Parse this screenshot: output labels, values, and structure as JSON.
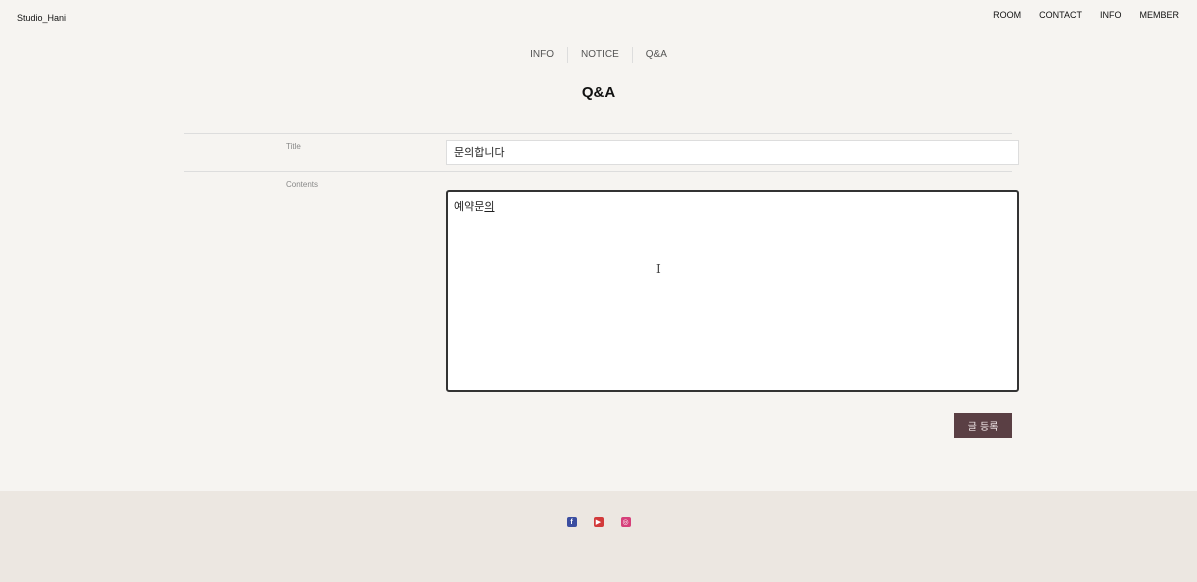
{
  "header": {
    "brand": "Studio_Hani",
    "nav": [
      "ROOM",
      "CONTACT",
      "INFO",
      "MEMBER"
    ]
  },
  "subnav": [
    "INFO",
    "NOTICE",
    "Q&A"
  ],
  "page_title": "Q&A",
  "form": {
    "title_label": "Title",
    "title_value": "문의합니다",
    "contents_label": "Contents",
    "contents_value_main": "예약문",
    "contents_value_composing": "의",
    "submit_label": "글 등록"
  },
  "footer": {
    "icons": [
      "facebook-icon",
      "youtube-icon",
      "instagram-icon"
    ]
  },
  "colors": {
    "background": "#f6f4f1",
    "footer": "#ece7e1",
    "button": "#5a3f44"
  }
}
